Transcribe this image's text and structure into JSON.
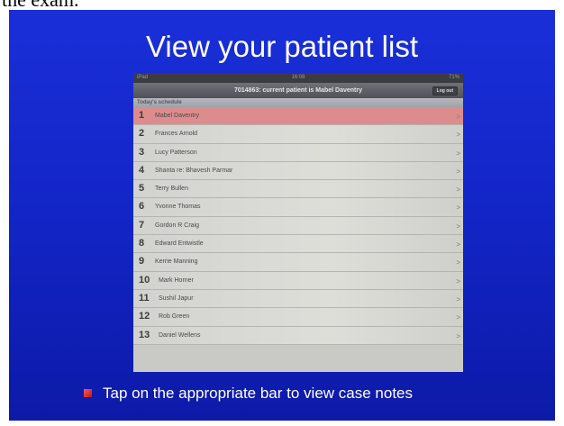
{
  "top_text": "the exam.",
  "slide": {
    "title": "View your patient list",
    "bullet": "Tap on the appropriate bar to view case notes"
  },
  "ipad": {
    "status_left": "iPad",
    "status_time": "16:08",
    "status_right": "71%",
    "nav_title": "7014863: current patient is Mabel Daventry",
    "logout_label": "Log out",
    "section_header": "Today's schedule",
    "patients": [
      {
        "num": "1",
        "name": "Mabel Daventry"
      },
      {
        "num": "2",
        "name": "Frances Arnold"
      },
      {
        "num": "3",
        "name": "Lucy Patterson"
      },
      {
        "num": "4",
        "name": "Shanta re: Bhavesh Parmar"
      },
      {
        "num": "5",
        "name": "Terry Bullen"
      },
      {
        "num": "6",
        "name": "Yvonne Thomas"
      },
      {
        "num": "7",
        "name": "Gordon R Craig"
      },
      {
        "num": "8",
        "name": "Edward Entwistle"
      },
      {
        "num": "9",
        "name": "Kerrie Manning"
      },
      {
        "num": "10",
        "name": "Mark Horner"
      },
      {
        "num": "11",
        "name": "Sushil Japur"
      },
      {
        "num": "12",
        "name": "Rob Green"
      },
      {
        "num": "13",
        "name": "Daniel Wellens"
      }
    ],
    "chevron": ">"
  }
}
